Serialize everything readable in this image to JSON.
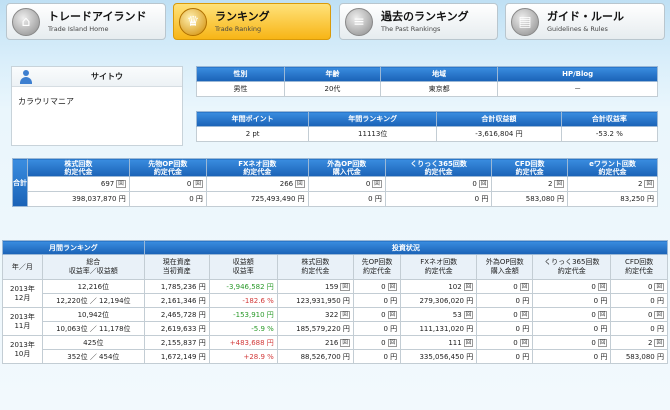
{
  "nav": [
    {
      "title": "トレードアイランド",
      "sub": "Trade Island Home",
      "icon": "house-icon",
      "active": false
    },
    {
      "title": "ランキング",
      "sub": "Trade Ranking",
      "icon": "crown-icon",
      "active": true
    },
    {
      "title": "過去のランキング",
      "sub": "The Past Rankings",
      "icon": "ranking-list-icon",
      "active": false
    },
    {
      "title": "ガイド・ルール",
      "sub": "Guidelines & Rules",
      "icon": "book-icon",
      "active": false
    }
  ],
  "profile": {
    "name": "サイトウ",
    "description": "カラウリマニア"
  },
  "info1": {
    "headers": [
      "性別",
      "年齢",
      "地域",
      "HP/Blog"
    ],
    "values": [
      "男性",
      "20代",
      "東京都",
      "－"
    ]
  },
  "info2": {
    "headers": [
      "年間ポイント",
      "年間ランキング",
      "合計収益額",
      "合計収益率"
    ],
    "values": [
      "2 pt",
      "11113位",
      "-3,616,804 円",
      "-53.2 %"
    ]
  },
  "totals": {
    "side_label": "合計",
    "headers": [
      [
        "株式回数",
        "約定代金"
      ],
      [
        "先物OP回数",
        "約定代金"
      ],
      [
        "FXネオ回数",
        "約定代金"
      ],
      [
        "外為OP回数",
        "購入代金"
      ],
      [
        "くりっく365回数",
        "約定代金"
      ],
      [
        "CFD回数",
        "約定代金"
      ],
      [
        "eワラント回数",
        "約定代金"
      ]
    ],
    "counts": [
      "697",
      "0",
      "266",
      "0",
      "0",
      "2",
      "2"
    ],
    "amounts": [
      "398,037,870",
      "0",
      "725,493,490",
      "0",
      "0",
      "583,080",
      "83,250"
    ],
    "count_unit": "回",
    "yen_unit": "円"
  },
  "monthly": {
    "title_left": "月間ランキング",
    "title_right": "投資状況",
    "headers": [
      "年／月",
      "総合\n収益率／収益額",
      "現在資産\n当初資産",
      "収益額\n収益率",
      "株式回数\n約定代金",
      "先OP回数\n約定代金",
      "FXネオ回数\n約定代金",
      "外為OP回数\n購入金額",
      "くりっく365回数\n約定代金",
      "CFD回数\n約定代金"
    ],
    "rows": [
      {
        "ym": "2013年\n12月",
        "rank1": "12,216位",
        "rank2": "12,220位 ／ 12,194位",
        "asset_now": "1,785,236 円",
        "asset_init": "2,161,346 円",
        "profit": "-3,946,582 円",
        "rate": "-182.6 %",
        "profit_class": "pos",
        "rate_class": "pctneg",
        "stock_c": "159",
        "stock_a": "123,931,950",
        "op_c": "0",
        "op_a": "0",
        "fx_c": "102",
        "fx_a": "279,306,020",
        "gop_c": "0",
        "gop_a": "0",
        "k365_c": "0",
        "k365_a": "0",
        "cfd_c": "0",
        "cfd_a": "0"
      },
      {
        "ym": "2013年\n11月",
        "rank1": "10,942位",
        "rank2": "10,063位 ／ 11,178位",
        "asset_now": "2,465,728 円",
        "asset_init": "2,619,633 円",
        "profit": "-153,910 円",
        "rate": "-5.9 %",
        "profit_class": "pos",
        "rate_class": "pctpos",
        "stock_c": "322",
        "stock_a": "185,579,220",
        "op_c": "0",
        "op_a": "0",
        "fx_c": "53",
        "fx_a": "111,131,020",
        "gop_c": "0",
        "gop_a": "0",
        "k365_c": "0",
        "k365_a": "0",
        "cfd_c": "0",
        "cfd_a": "0"
      },
      {
        "ym": "2013年\n10月",
        "rank1": "425位",
        "rank2": "352位 ／ 454位",
        "asset_now": "2,155,837 円",
        "asset_init": "1,672,149 円",
        "profit": "+483,688 円",
        "rate": "+28.9 %",
        "profit_class": "neg",
        "rate_class": "pctneg",
        "stock_c": "216",
        "stock_a": "88,526,700",
        "op_c": "0",
        "op_a": "0",
        "fx_c": "111",
        "fx_a": "335,056,450",
        "gop_c": "0",
        "gop_a": "0",
        "k365_c": "0",
        "k365_a": "0",
        "cfd_c": "2",
        "cfd_a": "583,080"
      }
    ]
  }
}
